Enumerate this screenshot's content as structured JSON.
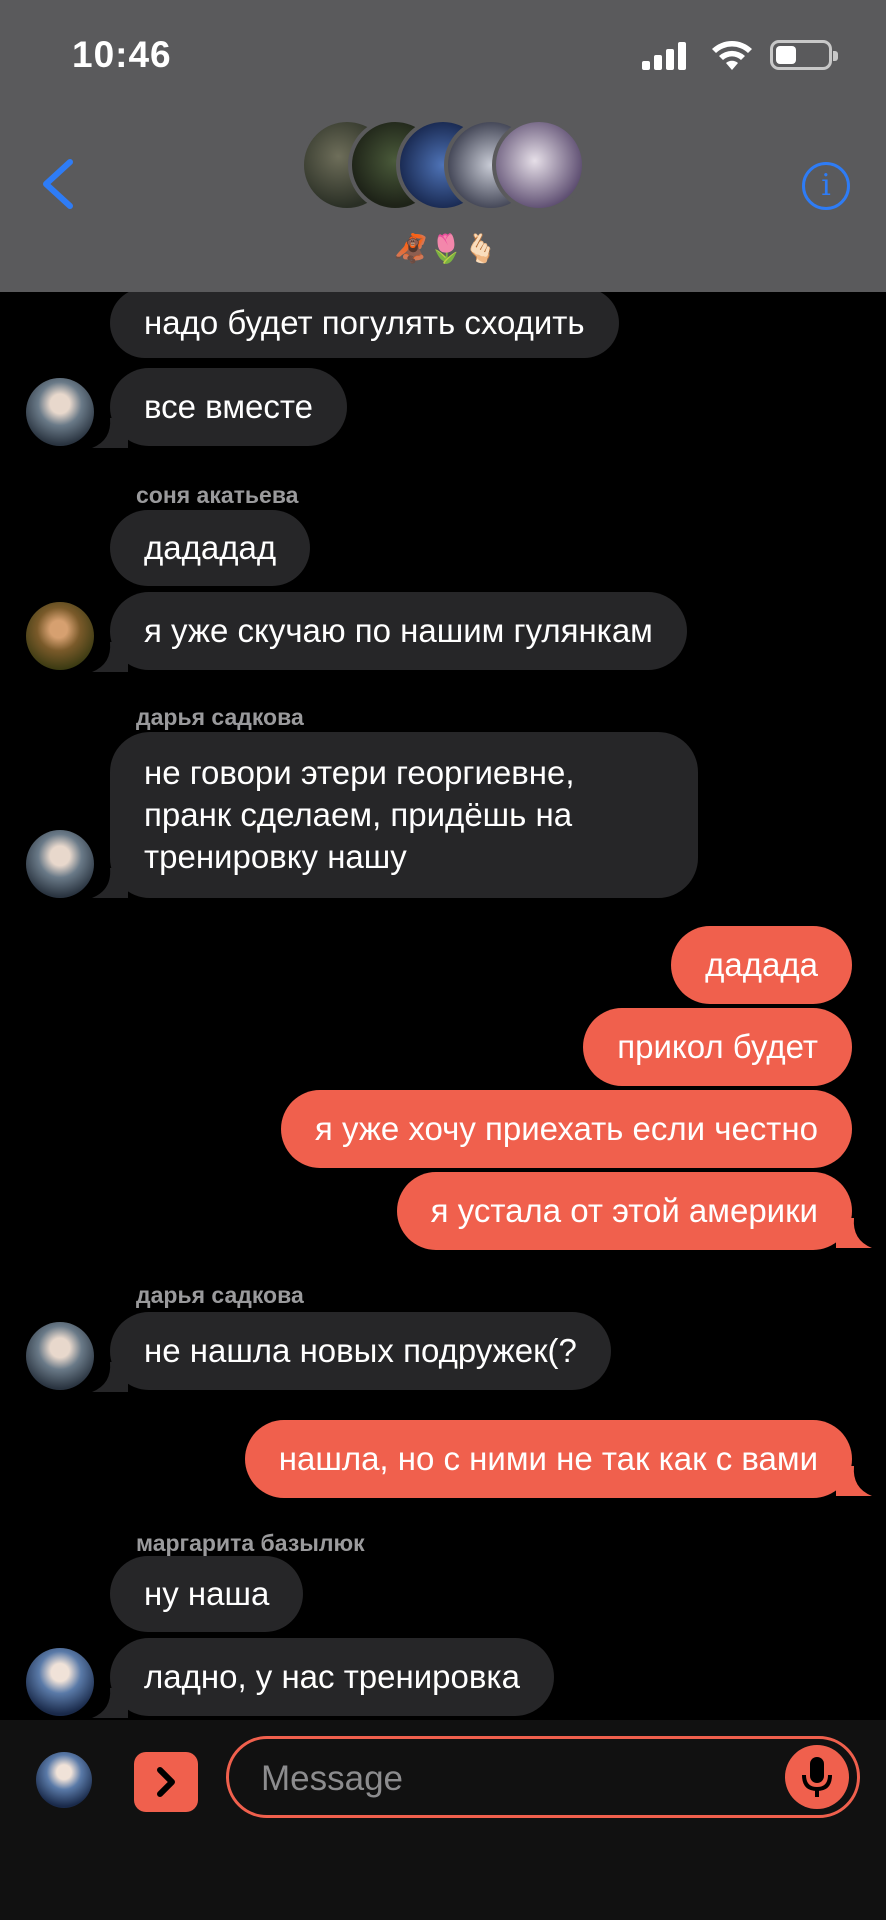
{
  "status_bar": {
    "time": "10:46"
  },
  "header": {
    "emojis": "🦧🌷🫰🏻"
  },
  "messages": [
    {
      "sender": "",
      "text": "надо будет погулять сходить",
      "direction": "in"
    },
    {
      "sender": "",
      "text": "все вместе",
      "direction": "in"
    },
    {
      "sender": "соня акатьева",
      "text": "дададад",
      "direction": "in"
    },
    {
      "sender": "",
      "text": "я уже скучаю по нашим гулянкам",
      "direction": "in"
    },
    {
      "sender": "дарья садкова",
      "text": "не говори этери георгиевне, пранк сделаем, придёшь на тренировку нашу",
      "direction": "in"
    },
    {
      "sender": "",
      "text": "дадада",
      "direction": "out"
    },
    {
      "sender": "",
      "text": "прикол будет",
      "direction": "out"
    },
    {
      "sender": "",
      "text": "я уже хочу приехать если честно",
      "direction": "out"
    },
    {
      "sender": "",
      "text": "я устала от этой америки",
      "direction": "out"
    },
    {
      "sender": "дарья садкова",
      "text": "не нашла новых подружек(?",
      "direction": "in"
    },
    {
      "sender": "",
      "text": "нашла, но с ними не так как с вами",
      "direction": "out"
    },
    {
      "sender": "маргарита базылюк",
      "text": "ну наша",
      "direction": "in"
    },
    {
      "sender": "",
      "text": "ладно, у нас тренировка",
      "direction": "in"
    }
  ],
  "input": {
    "placeholder": "Message"
  },
  "colors": {
    "accent": "#f0604d",
    "incoming": "#262628",
    "header_bg": "#5a5a5c",
    "link_blue": "#2e7cf6"
  }
}
